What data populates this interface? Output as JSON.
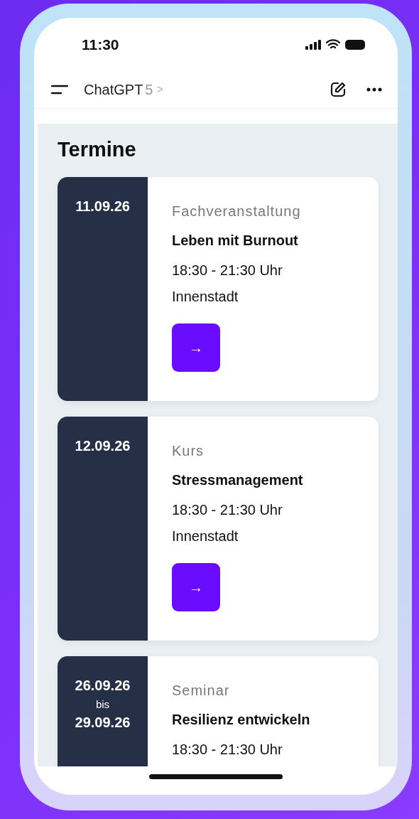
{
  "status_bar": {
    "time": "11:30"
  },
  "nav": {
    "title": "ChatGPT",
    "version": "5",
    "chevron": ">"
  },
  "heading": "Termine",
  "events": [
    {
      "date_from": "11.09.26",
      "category": "Fachveranstaltung",
      "title": "Leben mit Burnout",
      "time": "18:30 - 21:30 Uhr",
      "place": "Innenstadt",
      "action": "→"
    },
    {
      "date_from": "12.09.26",
      "category": "Kurs",
      "title": "Stressmanagement",
      "time": "18:30 - 21:30 Uhr",
      "place": "Innenstadt",
      "action": "→"
    },
    {
      "date_from": "26.09.26",
      "date_sep": "bis",
      "date_to": "29.09.26",
      "category": "Seminar",
      "title": "Resilienz entwickeln",
      "time": "18:30 - 21:30 Uhr"
    }
  ]
}
